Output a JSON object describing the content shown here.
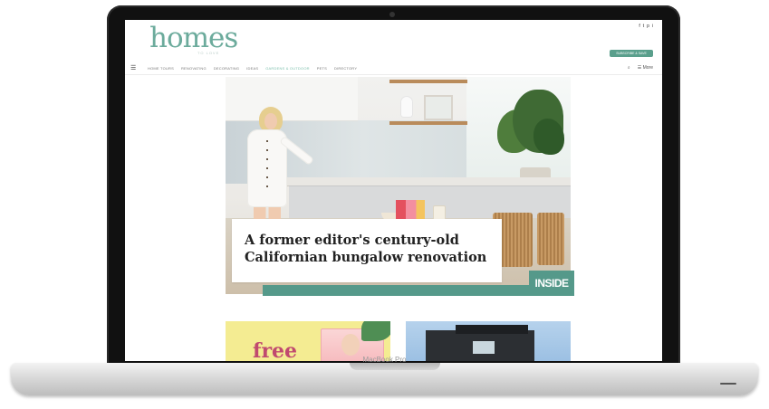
{
  "device": {
    "label": "MacBook Pro"
  },
  "site": {
    "logo": "homes",
    "tagline": "TO LOVE",
    "cta_label": "SUBSCRIBE & SAVE"
  },
  "social": [
    "f",
    "t",
    "p",
    "i"
  ],
  "nav": {
    "items": [
      "HOME TOURS",
      "RENOVATING",
      "DECORATING",
      "IDEAS",
      "GARDENS & OUTDOOR",
      "PETS",
      "DIRECTORY"
    ],
    "active_index": 4,
    "right": [
      "⌕",
      "☰ More"
    ]
  },
  "hero": {
    "headline": "A former editor's century-old Californian bungalow renovation",
    "badge": "INSIDE",
    "colors": {
      "accent": "#55998a"
    }
  },
  "cards": [
    {
      "title": "free"
    },
    {
      "title": ""
    }
  ]
}
